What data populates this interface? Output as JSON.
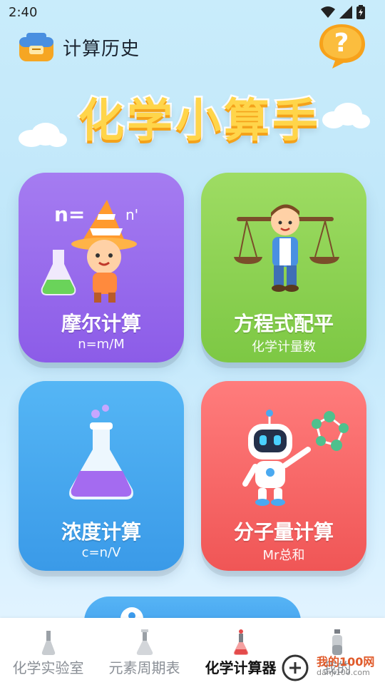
{
  "status_bar": {
    "time": "2:40"
  },
  "header": {
    "history_label": "计算历史",
    "help_symbol": "?"
  },
  "banner": {
    "title": "化学小算手"
  },
  "cards": [
    {
      "title": "摩尔计算",
      "subtitle": "n=m/M",
      "formula_art": "n=",
      "formula_art2": "n'"
    },
    {
      "title": "方程式配平",
      "subtitle": "化学计量数"
    },
    {
      "title": "浓度计算",
      "subtitle": "c=n/V"
    },
    {
      "title": "分子量计算",
      "subtitle": "Mr总和"
    }
  ],
  "bottom_nav": {
    "items": [
      {
        "label": "化学实验室",
        "active": false
      },
      {
        "label": "元素周期表",
        "active": false
      },
      {
        "label": "化学计算器",
        "active": true
      },
      {
        "label": "我的",
        "active": false
      }
    ]
  },
  "watermark": {
    "text": "我的100网",
    "sub": "danji100.com"
  },
  "colors": {
    "mole_card": "#9a6cec",
    "balance_card": "#8fd352",
    "concentration_card": "#4aa9f0",
    "mr_card": "#f86868",
    "title_yellow": "#ffd54a",
    "help_orange": "#f7a21b"
  }
}
